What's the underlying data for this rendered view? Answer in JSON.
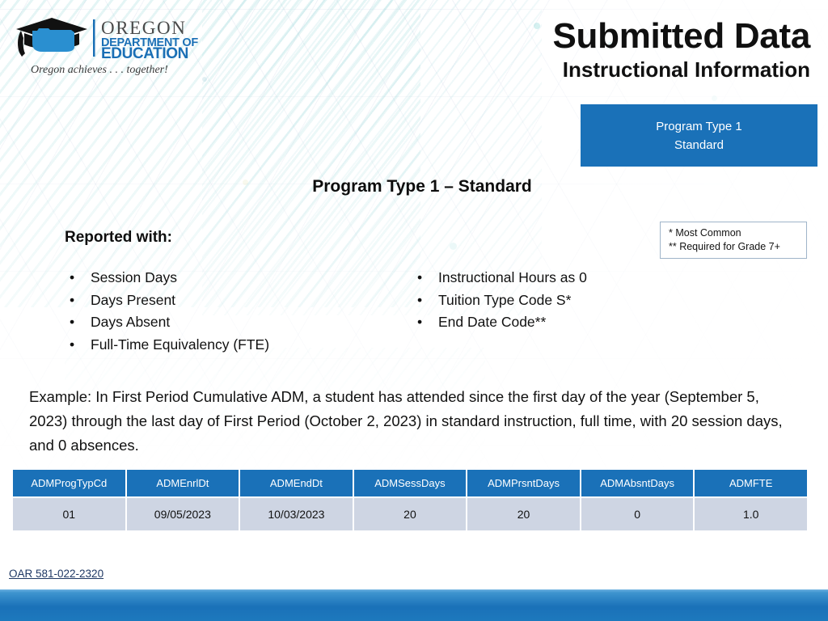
{
  "header": {
    "title": "Submitted Data",
    "subtitle": "Instructional Information",
    "logo": {
      "org_line1": "OREGON",
      "org_line2": "DEPARTMENT OF",
      "org_line3": "EDUCATION",
      "tagline": "Oregon achieves . . . together!"
    }
  },
  "banner": {
    "line1": "Program Type 1",
    "line2": "Standard",
    "color": "#1a71b8"
  },
  "section": {
    "heading": "Program Type 1 – Standard",
    "reported_with_label": "Reported with:"
  },
  "legend": {
    "line1": "* Most Common",
    "line2": "** Required for Grade 7+"
  },
  "bullets": {
    "bullet_glyph": "•",
    "left": [
      "Session Days",
      "Days Present",
      "Days Absent",
      "Full-Time Equivalency (FTE)"
    ],
    "right": [
      "Instructional Hours as 0",
      "Tuition Type Code S*",
      "End Date Code**"
    ]
  },
  "example": {
    "text": "Example: In First Period Cumulative ADM, a student has attended since the first day of the year (September 5, 2023) through the last day of First Period (October 2, 2023) in standard instruction, full time, with 20 session days, and 0 absences."
  },
  "table": {
    "headers": [
      "ADMProgTypCd",
      "ADMEnrlDt",
      "ADMEndDt",
      "ADMSessDays",
      "ADMPrsntDays",
      "ADMAbsntDays",
      "ADMFTE"
    ],
    "rows": [
      [
        "01",
        "09/05/2023",
        "10/03/2023",
        "20",
        "20",
        "0",
        "1.0"
      ]
    ],
    "header_color": "#1a71b8",
    "cell_color": "#ced5e3"
  },
  "footer": {
    "oar_link": "OAR 581-022-2320",
    "bar_color": "#1a71b8"
  }
}
